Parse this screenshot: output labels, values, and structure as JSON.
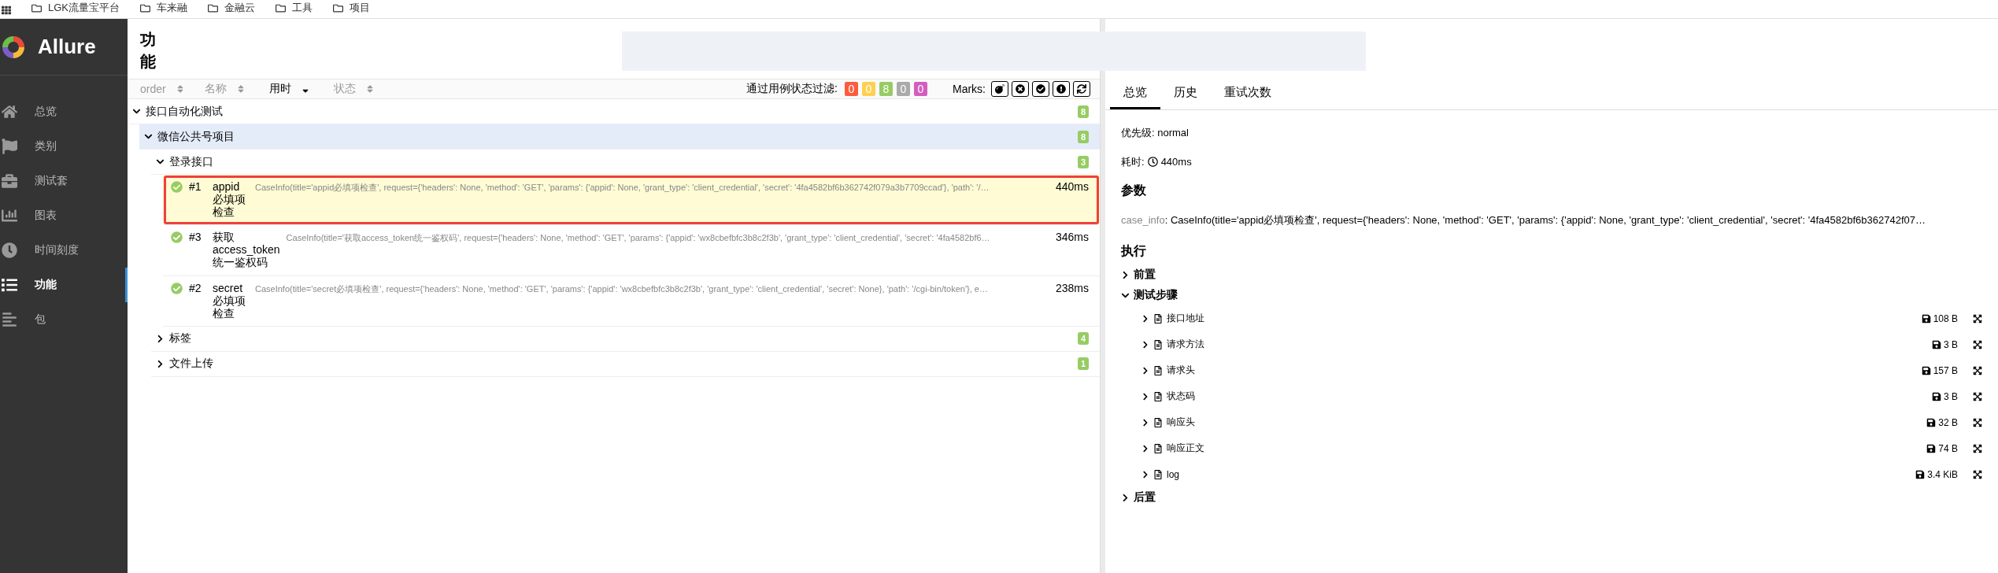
{
  "bookmarks": [
    {
      "label": "LGK流量宝平台"
    },
    {
      "label": "车来融"
    },
    {
      "label": "金融云"
    },
    {
      "label": "工具"
    },
    {
      "label": "项目"
    }
  ],
  "sidebar": {
    "brand": "Allure",
    "items": [
      {
        "label": "总览",
        "selected": false
      },
      {
        "label": "类别",
        "selected": false
      },
      {
        "label": "测试套",
        "selected": false
      },
      {
        "label": "图表",
        "selected": false
      },
      {
        "label": "时间刻度",
        "selected": false
      },
      {
        "label": "功能",
        "selected": true
      },
      {
        "label": "包",
        "selected": false
      }
    ]
  },
  "main": {
    "title": "功能",
    "sort_columns": [
      {
        "label": "order",
        "selected": false
      },
      {
        "label": "名称",
        "selected": false
      },
      {
        "label": "用时",
        "selected": true
      },
      {
        "label": "状态",
        "selected": false
      }
    ],
    "filter": {
      "label": "通过用例状态过滤:",
      "statuses": [
        {
          "count": "0",
          "color": "#fd5a3e"
        },
        {
          "count": "0",
          "color": "#ffd050"
        },
        {
          "count": "8",
          "color": "#97cc64"
        },
        {
          "count": "0",
          "color": "#aaaaaa"
        },
        {
          "count": "0",
          "color": "#d35ebe"
        }
      ]
    },
    "marks": {
      "label": "Marks:",
      "buttons": [
        {
          "kind": "flaky"
        },
        {
          "kind": "new-failed"
        },
        {
          "kind": "new-passed"
        },
        {
          "kind": "new-broken"
        },
        {
          "kind": "retries"
        }
      ]
    },
    "tree": [
      {
        "label": "接口自动化测试",
        "count": "8",
        "expanded": true,
        "selected": false,
        "children": [
          {
            "label": "微信公共号项目",
            "count": "8",
            "expanded": true,
            "selected": true,
            "children": [
              {
                "label": "登录接口",
                "count": "3",
                "expanded": true,
                "selected": false,
                "tests": [
                  {
                    "number": "#1",
                    "name": "appid必填项检查",
                    "description": "CaseInfo(title='appid必填项检查', request={'headers': None, 'method': 'GET', 'params': {'appid': None, 'grant_type': 'client_credential', 'secret': '4fa4582bf6b362742f079a3b7709ccad'}, 'path': '/…",
                    "duration": "440ms",
                    "selected": true,
                    "annotated": true
                  },
                  {
                    "number": "#3",
                    "name": "获取access_token统一鉴权码",
                    "description": "CaseInfo(title='获取access_token统一鉴权码', request={'headers': None, 'method': 'GET', 'params': {'appid': 'wx8cbefbfc3b8c2f3b', 'grant_type': 'client_credential', 'secret': '4fa4582bf6…",
                    "duration": "346ms",
                    "selected": false,
                    "annotated": false
                  },
                  {
                    "number": "#2",
                    "name": "secret必填项检查",
                    "description": "CaseInfo(title='secret必填项检查', request={'headers': None, 'method': 'GET', 'params': {'appid': 'wx8cbefbfc3b8c2f3b', 'grant_type': 'client_credential', 'secret': None}, 'path': '/cgi-bin/token'}, e…",
                    "duration": "238ms",
                    "selected": false,
                    "annotated": false
                  }
                ]
              },
              {
                "label": "标签",
                "count": "4",
                "expanded": false,
                "selected": false
              },
              {
                "label": "文件上传",
                "count": "1",
                "expanded": false,
                "selected": false
              }
            ]
          }
        ]
      }
    ]
  },
  "detail": {
    "tabs": [
      {
        "label": "总览",
        "selected": true
      },
      {
        "label": "历史",
        "selected": false
      },
      {
        "label": "重试次数",
        "selected": false
      }
    ],
    "priority": {
      "label": "优先级:",
      "value": "normal"
    },
    "duration": {
      "label": "耗时:",
      "value": "440ms"
    },
    "parameters": {
      "title": "参数",
      "items": [
        {
          "name": "case_info",
          "value": ": CaseInfo(title='appid必填项检查', request={'headers': None, 'method': 'GET', 'params': {'appid': None, 'grant_type': 'client_credential', 'secret': '4fa4582bf6b362742f07…"
        }
      ]
    },
    "execution": {
      "title": "执行",
      "stages": [
        {
          "label": "前置",
          "expanded": false
        },
        {
          "label": "测试步骤",
          "expanded": true,
          "attachments": [
            {
              "name": "接口地址",
              "size": "108 B"
            },
            {
              "name": "请求方法",
              "size": "3 B"
            },
            {
              "name": "请求头",
              "size": "157 B"
            },
            {
              "name": "状态码",
              "size": "3 B"
            },
            {
              "name": "响应头",
              "size": "32 B"
            },
            {
              "name": "响应正文",
              "size": "74 B"
            },
            {
              "name": "log",
              "size": "3.4 KiB"
            }
          ]
        },
        {
          "label": "后置",
          "expanded": false
        }
      ]
    }
  }
}
